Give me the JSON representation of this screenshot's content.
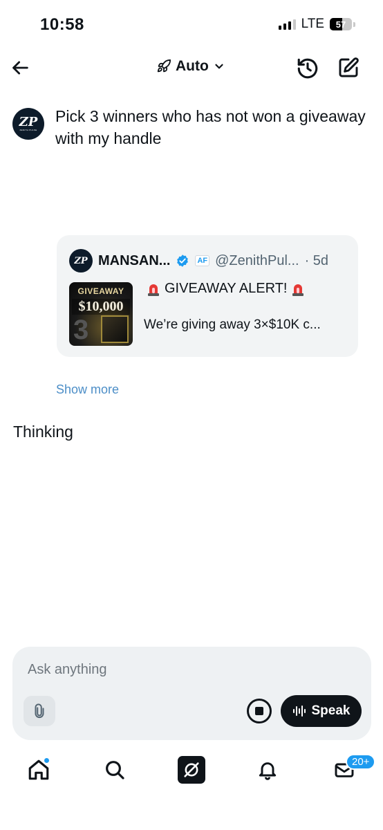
{
  "status_bar": {
    "time": "10:58",
    "network": "LTE",
    "battery": "57"
  },
  "header": {
    "mode_label": "Auto",
    "icons": {
      "back": "arrow-left-icon",
      "mode": "rocket-icon",
      "history": "history-icon",
      "compose": "compose-icon"
    }
  },
  "conversation": {
    "user_message": "Pick 3 winners who has not won a giveaway with my handle",
    "avatar_logo": "ZP",
    "avatar_caption": "ZENITH PULSE",
    "quoted_post": {
      "name": "MANSAN...",
      "affiliate_badge": "AF",
      "handle": "@ZenithPul...",
      "age": "· 5d",
      "title": "GIVEAWAY ALERT!",
      "body": "We’re giving away 3×$10K c...",
      "thumbnail_title": "GIVEAWAY",
      "thumbnail_amount": "$10,000",
      "thumbnail_number": "3"
    },
    "show_more": "Show more",
    "status": "Thinking"
  },
  "composer": {
    "placeholder": "Ask anything",
    "speak_label": "Speak"
  },
  "bottom_nav": {
    "items": [
      "home-icon",
      "search-icon",
      "grok-icon",
      "notifications-icon",
      "messages-icon"
    ],
    "messages_badge": "20+"
  },
  "colors": {
    "accent": "#1d9bf0",
    "link": "#4c8ec7",
    "card_bg": "#f2f4f5",
    "composer_bg": "#eef1f3",
    "text": "#0f1419"
  }
}
